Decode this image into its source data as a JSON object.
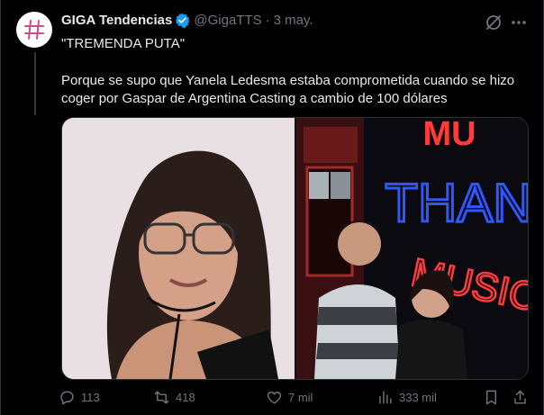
{
  "tweet": {
    "author_name": "GIGA Tendencias",
    "handle": "@GigaTTS",
    "separator": "·",
    "date": "3 may.",
    "title_line": "\"TREMENDA PUTA\"",
    "body": "Porque se supo que Yanela Ledesma estaba comprometida cuando se hizo coger por Gaspar de Argentina Casting a cambio de 100 dólares"
  },
  "neon_sign": {
    "top": "MU",
    "middle": "THAN",
    "bottom": "MUSIC"
  },
  "actions": {
    "replies": "113",
    "reposts": "418",
    "likes": "7 mil",
    "views": "333 mil"
  },
  "colors": {
    "background": "#000000",
    "verified": "#1d9bf0",
    "muted": "#71767b",
    "neon_red": "#ff3b3b",
    "neon_blue": "#2f57ff"
  },
  "icons": [
    "hashtag-logo-icon",
    "verified-badge-icon",
    "grok-icon",
    "more-icon",
    "reply-icon",
    "repost-icon",
    "like-icon",
    "views-icon",
    "bookmark-icon",
    "share-icon"
  ]
}
